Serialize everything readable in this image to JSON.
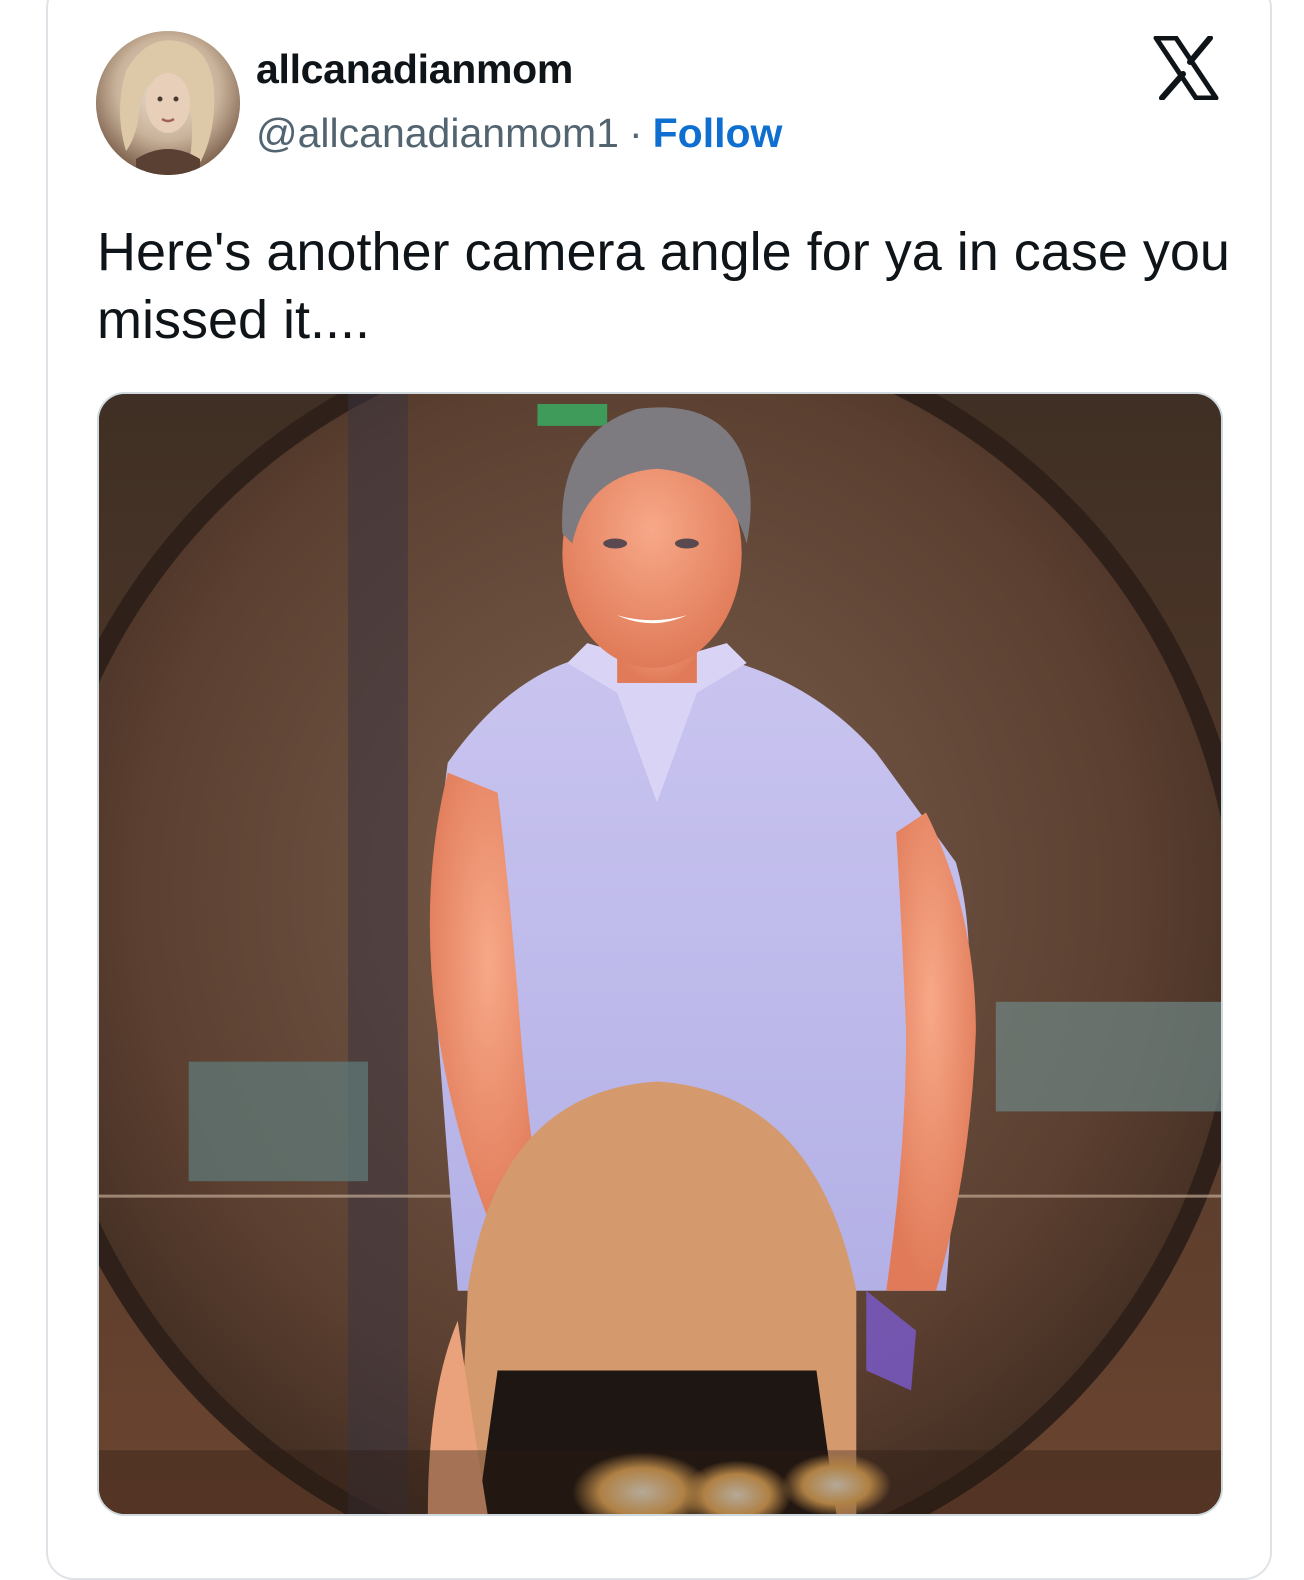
{
  "tweet": {
    "display_name": "allcanadianmom",
    "handle": "@allcanadianmom1",
    "separator": "·",
    "follow_label": "Follow",
    "text": "Here's another camera angle for ya in case you missed it....",
    "platform_icon": "x-logo-icon",
    "media": {
      "kind": "photo"
    }
  },
  "colors": {
    "link_blue": "#0f6fd0",
    "text_primary": "#0f1419",
    "text_secondary": "#536471",
    "card_border": "#dfe3e8"
  }
}
